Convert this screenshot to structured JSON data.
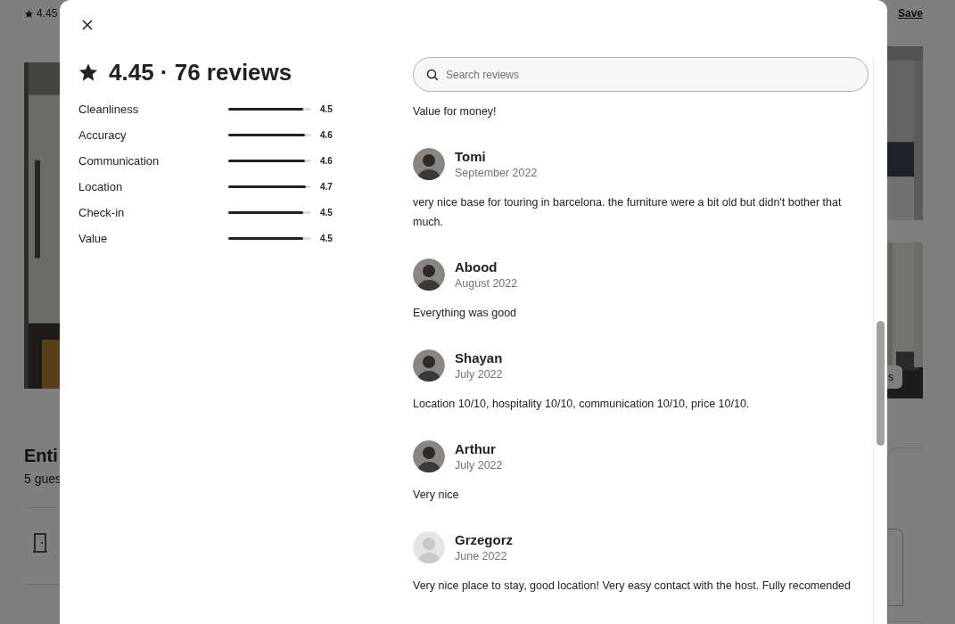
{
  "background_page": {
    "header_rating": "4.45",
    "save_link": "Save",
    "photo_button": "s",
    "listing_title": "Enti",
    "listing_subtitle": "5 gues"
  },
  "modal": {
    "title": "4.45 · 76 reviews",
    "categories": [
      {
        "label": "Cleanliness",
        "score": "4.5",
        "level": 0.9
      },
      {
        "label": "Accuracy",
        "score": "4.6",
        "level": 0.92
      },
      {
        "label": "Communication",
        "score": "4.6",
        "level": 0.92
      },
      {
        "label": "Location",
        "score": "4.7",
        "level": 0.94
      },
      {
        "label": "Check-in",
        "score": "4.5",
        "level": 0.9
      },
      {
        "label": "Value",
        "score": "4.5",
        "level": 0.9
      }
    ],
    "search": {
      "placeholder": "Search reviews"
    },
    "partial_review_text": "Value for money!",
    "reviews": [
      {
        "name": "Tomi",
        "date": "September 2022",
        "text": "very nice base for touring in barcelona. the furniture were a bit old but didn't bother that much."
      },
      {
        "name": "Abood",
        "date": "August 2022",
        "text": "Everything was good"
      },
      {
        "name": "Shayan",
        "date": "July 2022",
        "text": "Location 10/10, hospitality 10/10, communication 10/10, price 10/10."
      },
      {
        "name": "Arthur",
        "date": "July 2022",
        "text": "Very nice"
      },
      {
        "name": "Grzegorz",
        "date": "June 2022",
        "kind": "default",
        "text": "Very nice place to stay, good location! Very easy contact with the host. Fully recomended"
      }
    ]
  }
}
